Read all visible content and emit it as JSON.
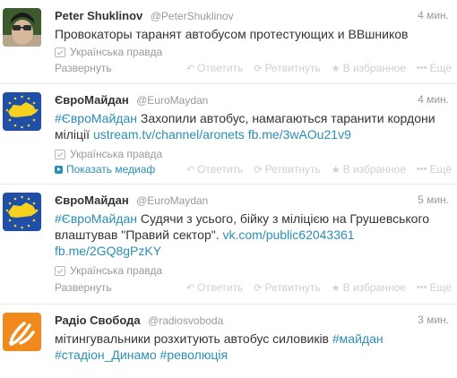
{
  "tweets": [
    {
      "name": "Peter Shuklinov",
      "handle": "@PeterShuklinov",
      "time": "4 мин.",
      "text_parts": [
        "Провокаторы таранят автобусом протестующих и ВВшников"
      ],
      "place": "Українська правда",
      "footer_link": "Развернуть",
      "actions": {
        "reply": "Ответить",
        "retweet": "Ретвитнуть",
        "favorite": "В избранное",
        "more": "Ещё"
      }
    },
    {
      "name": "ЄвроМайдан",
      "handle": "@EuroMaydan",
      "time": "4 мин.",
      "text_parts": [
        "#ЄвроМайдан",
        " Захопили автобус, намагаються таранити кордони міліції ",
        "ustream.tv/channel/aronets",
        " ",
        "fb.me/3wAOu21v9"
      ],
      "place": "Українська правда",
      "footer_link": "Показать медиаф",
      "actions": {
        "reply": "Ответить",
        "retweet": "Ретвитнуть",
        "favorite": "В избранное",
        "more": "Ещё"
      }
    },
    {
      "name": "ЄвроМайдан",
      "handle": "@EuroMaydan",
      "time": "5 мин.",
      "text_parts": [
        "#ЄвроМайдан",
        " Судячи з усього, бійку з міліцією на Грушевського влаштував \"Правий сектор\". ",
        "vk.com/public62043361",
        " ",
        "fb.me/2GQ8gPzKY"
      ],
      "place": "Українська правда",
      "footer_link": "Развернуть",
      "actions": {
        "reply": "Ответить",
        "retweet": "Ретвитнуть",
        "favorite": "В избранное",
        "more": "Ещё"
      }
    },
    {
      "name": "Радіо Свобода",
      "handle": "@radiosvoboda",
      "time": "3 мин.",
      "text_parts": [
        "мітингувальники розхитують автобус силовиків ",
        "#майдан",
        " ",
        "#стадіон_Динамо",
        " ",
        "#революція"
      ]
    }
  ],
  "colors": {
    "link": "#2a8eb6",
    "muted": "#999999",
    "text": "#333333"
  },
  "icons": {
    "pin": "location-pin-icon",
    "reply": "reply-icon",
    "retweet": "retweet-icon",
    "favorite": "star-icon",
    "more": "more-dots-icon",
    "media": "play-icon"
  }
}
